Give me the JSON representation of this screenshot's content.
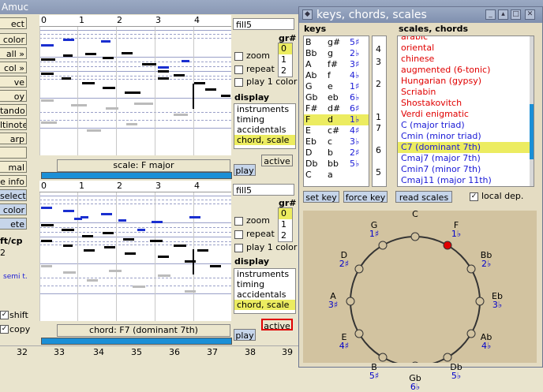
{
  "bg_window": {
    "title": "Amuc"
  },
  "toolbar": {
    "items": [
      "ect",
      "color",
      "all »",
      "col »",
      "ve",
      "oy",
      "tando",
      "ltinote",
      "arp",
      "",
      "mal",
      "e info",
      "select",
      "color",
      "ete"
    ],
    "shift_cp_label": "ft/cp",
    "shift_cp_value": "2",
    "semi_label": "semi t.",
    "shift_label": "shift",
    "copy_label": "copy"
  },
  "ruler": {
    "bars": [
      "0",
      "1",
      "2",
      "3",
      "4"
    ]
  },
  "panel1": {
    "field": "fill5",
    "gr_title": "gr#",
    "gr_items": [
      "0",
      "1",
      "2"
    ],
    "zoom_label": "zoom",
    "repeat_label": "repeat",
    "play1color_label": "play 1 color",
    "display_title": "display",
    "display_items": [
      "instruments",
      "timing",
      "accidentals",
      "chord, scale"
    ],
    "active_label": "active",
    "play_label": "play",
    "scale_tag": "scale: F major"
  },
  "panel2": {
    "field": "fill5",
    "gr_title": "gr#",
    "gr_items": [
      "0",
      "1",
      "2"
    ],
    "zoom_label": "zoom",
    "repeat_label": "repeat",
    "play1color_label": "play 1 color",
    "display_title": "display",
    "display_items": [
      "instruments",
      "timing",
      "accidentals",
      "chord, scale"
    ],
    "active_label": "active",
    "play_label": "play",
    "scale_tag": "chord: F7 (dominant 7th)"
  },
  "bottom_ruler": [
    "32",
    "33",
    "34",
    "35",
    "36",
    "37",
    "38",
    "39"
  ],
  "dialog": {
    "title": "keys, chords, scales",
    "keys_header": "keys",
    "scales_header": "scales, chords",
    "keys": [
      [
        "B",
        "g#",
        "5♯"
      ],
      [
        "Bb",
        "g",
        "2♭"
      ],
      [
        "A",
        "f#",
        "3♯"
      ],
      [
        "Ab",
        "f",
        "4♭"
      ],
      [
        "G",
        "e",
        "1♯"
      ],
      [
        "Gb",
        "eb",
        "6♭"
      ],
      [
        "F#",
        "d#",
        "6♯"
      ],
      [
        "F",
        "d",
        "1♭"
      ],
      [
        "E",
        "c#",
        "4♯"
      ],
      [
        "Eb",
        "c",
        "3♭"
      ],
      [
        "D",
        "b",
        "2♯"
      ],
      [
        "Db",
        "bb",
        "5♭"
      ],
      [
        "C",
        "a",
        ""
      ]
    ],
    "numbers": [
      "4",
      "3",
      "2",
      "1",
      "7",
      "6",
      "5"
    ],
    "scales": [
      {
        "name": "arabic",
        "color": "#e00000"
      },
      {
        "name": "oriental",
        "color": "#e00000"
      },
      {
        "name": "chinese",
        "color": "#e00000"
      },
      {
        "name": "augmented (6-tonic)",
        "color": "#e00000"
      },
      {
        "name": "Hungarian (gypsy)",
        "color": "#e00000"
      },
      {
        "name": "Scriabin",
        "color": "#e00000"
      },
      {
        "name": "Shostakovitch",
        "color": "#e00000"
      },
      {
        "name": "Verdi enigmatic",
        "color": "#e00000"
      },
      {
        "name": "C (major triad)",
        "color": "#1a1ad6"
      },
      {
        "name": "Cmin (minor triad)",
        "color": "#1a1ad6"
      },
      {
        "name": "C7 (dominant 7th)",
        "color": "#1a1ad6"
      },
      {
        "name": "Cmaj7 (major 7th)",
        "color": "#1a1ad6"
      },
      {
        "name": "Cmin7 (minor 7th)",
        "color": "#1a1ad6"
      },
      {
        "name": "Cmaj11 (major 11th)",
        "color": "#1a1ad6"
      }
    ],
    "set_key_label": "set key",
    "force_key_label": "force key",
    "read_scales_label": "read scales",
    "local_dep_label": "local dep.",
    "circle": [
      {
        "note": "C",
        "key": ""
      },
      {
        "note": "F",
        "key": "1♭"
      },
      {
        "note": "Bb",
        "key": "2♭"
      },
      {
        "note": "Eb",
        "key": "3♭"
      },
      {
        "note": "Ab",
        "key": "4♭"
      },
      {
        "note": "Db",
        "key": "5♭"
      },
      {
        "note": "Gb",
        "key": "6♭"
      },
      {
        "note": "B",
        "key": "5♯"
      },
      {
        "note": "E",
        "key": "4♯"
      },
      {
        "note": "A",
        "key": "3♯"
      },
      {
        "note": "D",
        "key": "2♯"
      },
      {
        "note": "G",
        "key": "1♯"
      }
    ],
    "active_note": "F"
  },
  "colors": {
    "highlight": "#ecec60",
    "accent_blue": "#c6d5ea",
    "active_red": "#e00000",
    "note_blue": "#1a2fd0"
  }
}
